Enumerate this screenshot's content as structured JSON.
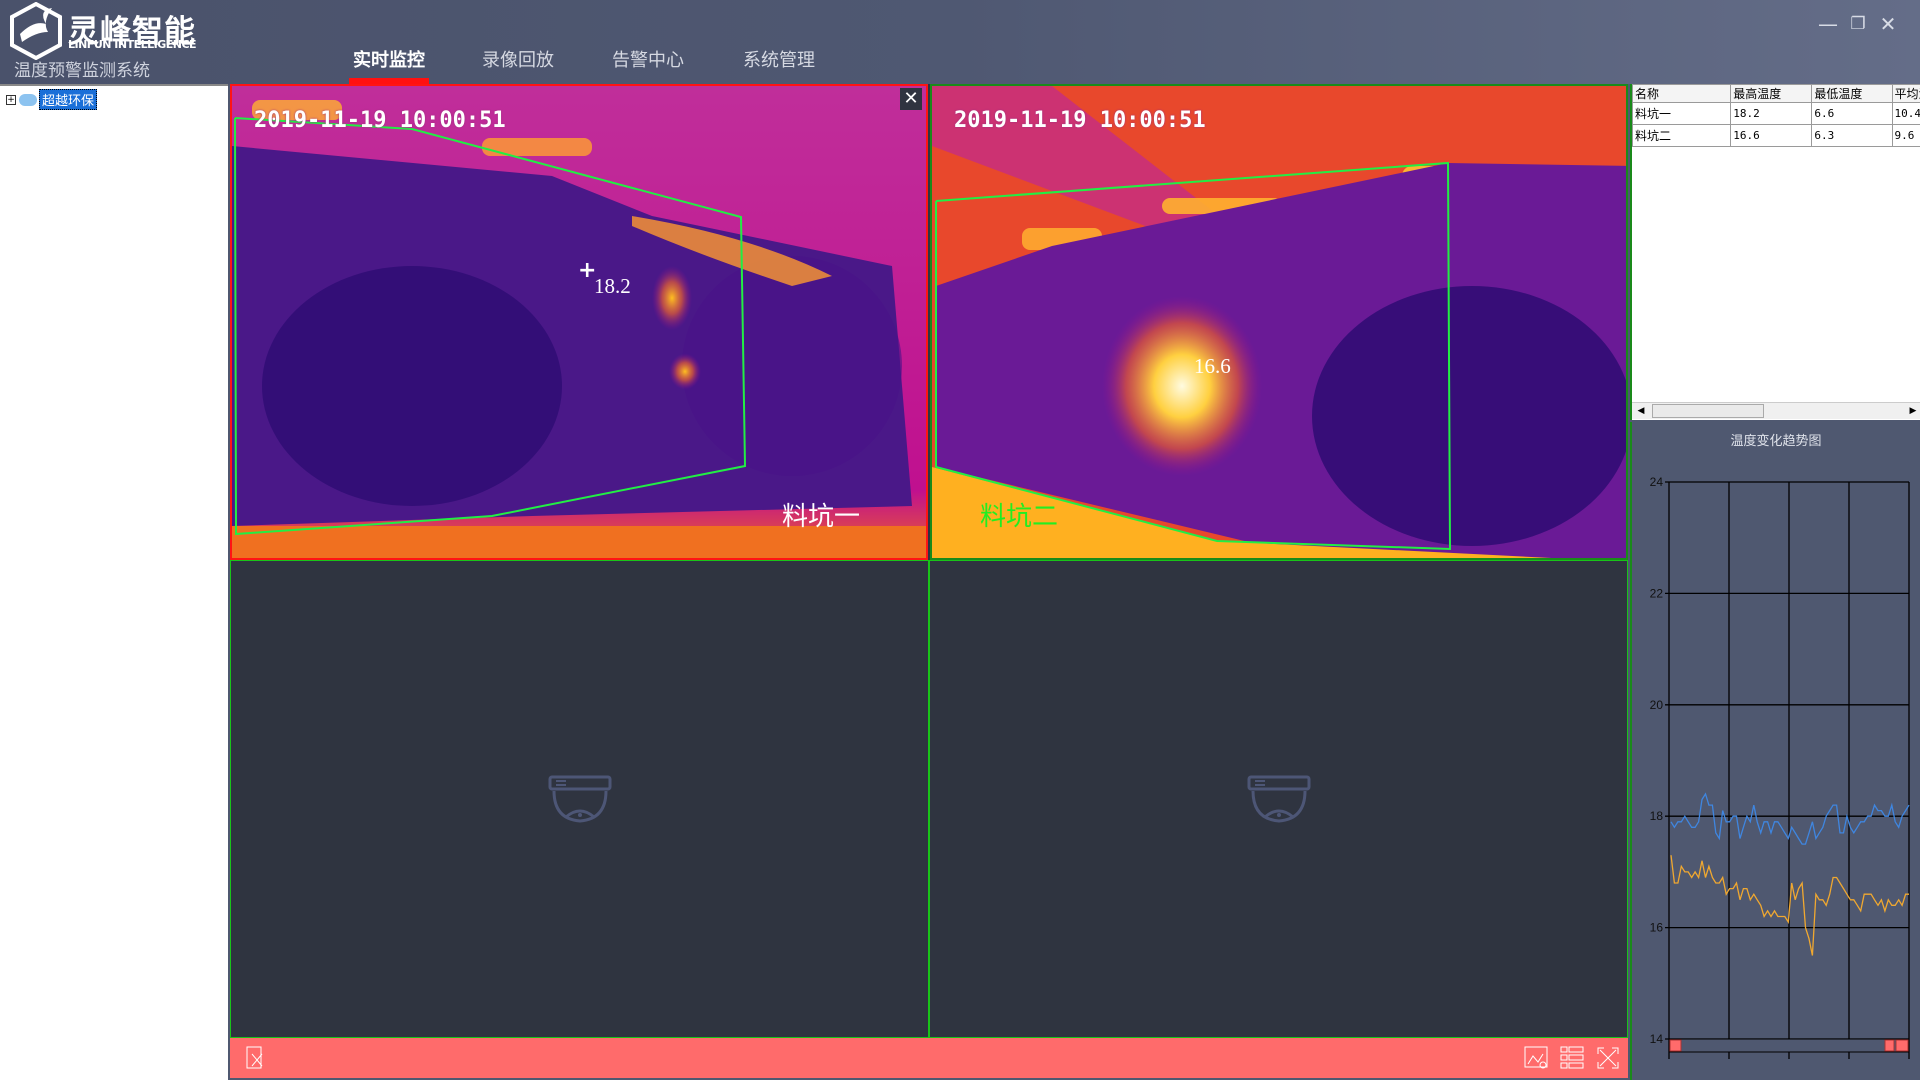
{
  "app": {
    "logo_cn": "灵峰智能",
    "logo_en": "LINFUN INTELLIGENCE",
    "system_name": "温度预警监测系统"
  },
  "nav": [
    {
      "label": "实时监控",
      "active": true
    },
    {
      "label": "录像回放"
    },
    {
      "label": "告警中心"
    },
    {
      "label": "系统管理"
    }
  ],
  "window": {
    "minimize": "—",
    "restore": "❐",
    "close": "✕"
  },
  "tree": {
    "root": "超越环保",
    "expander": "+"
  },
  "cameras": [
    {
      "timestamp": "2019-11-19 10:00:51",
      "max_temp": "18.2",
      "name": "料坑一",
      "name_color": "#ffffff",
      "close": "✕"
    },
    {
      "timestamp": "2019-11-19 10:00:51",
      "max_temp": "16.6",
      "name": "料坑二",
      "name_color": "#22ee22"
    }
  ],
  "colors": {
    "accent": "#ff1010",
    "toolbar": "#ff6b6b",
    "zone": "#22ee44",
    "series1": "#3f86e0",
    "series2": "#f0a830"
  },
  "table": {
    "columns": [
      "名称",
      "最高温度",
      "最低温度",
      "平均温度"
    ],
    "rows": [
      [
        "料坑一",
        "18.2",
        "6.6",
        "10.4"
      ],
      [
        "料坑二",
        "16.6",
        "6.3",
        "9.6"
      ]
    ]
  },
  "toolbar": {
    "icons": [
      "edit-icon",
      "image-icon",
      "layout-icon",
      "fullscreen-icon"
    ]
  },
  "chart_data": {
    "type": "line",
    "title": "温度变化趋势图",
    "ylim": [
      14,
      24
    ],
    "yticks": [
      "24",
      "22",
      "20",
      "18",
      "16",
      "14"
    ],
    "grid": true,
    "series": [
      {
        "color": "#3f86e0",
        "values": [
          17.9,
          17.8,
          17.9,
          17.9,
          18.0,
          17.9,
          17.8,
          17.8,
          17.9,
          18.3,
          18.4,
          18.2,
          18.2,
          17.7,
          17.6,
          18.1,
          17.9,
          17.9,
          18.0,
          18.0,
          17.6,
          17.8,
          18.0,
          17.9,
          18.2,
          17.9,
          17.7,
          17.9,
          17.9,
          17.7,
          17.9,
          17.9,
          17.8,
          17.7,
          17.6,
          17.8,
          17.7,
          17.6,
          17.5,
          17.5,
          17.7,
          17.9,
          17.6,
          17.7,
          17.8,
          18.0,
          18.1,
          18.2,
          18.2,
          17.7,
          17.7,
          18.0,
          17.8,
          17.7,
          17.8,
          17.9,
          17.9,
          18.0,
          18.0,
          18.2,
          18.1,
          18.1,
          18.0,
          18.0,
          18.2,
          17.9,
          17.8,
          18.0,
          18.1,
          18.2
        ]
      },
      {
        "color": "#f0a830",
        "values": [
          17.3,
          16.8,
          16.8,
          17.1,
          17.0,
          17.0,
          16.9,
          17.0,
          16.9,
          17.2,
          16.9,
          17.1,
          16.9,
          16.8,
          16.8,
          16.9,
          16.6,
          16.7,
          16.7,
          16.8,
          16.5,
          16.7,
          16.7,
          16.5,
          16.6,
          16.5,
          16.4,
          16.2,
          16.3,
          16.2,
          16.3,
          16.2,
          16.2,
          16.2,
          16.1,
          16.8,
          16.5,
          16.7,
          16.8,
          16.0,
          15.8,
          15.5,
          16.6,
          16.5,
          16.5,
          16.4,
          16.6,
          16.9,
          16.9,
          16.8,
          16.7,
          16.6,
          16.5,
          16.5,
          16.4,
          16.3,
          16.6,
          16.6,
          16.6,
          16.5,
          16.4,
          16.5,
          16.3,
          16.5,
          16.4,
          16.4,
          16.5,
          16.4,
          16.6,
          16.6
        ]
      }
    ]
  }
}
